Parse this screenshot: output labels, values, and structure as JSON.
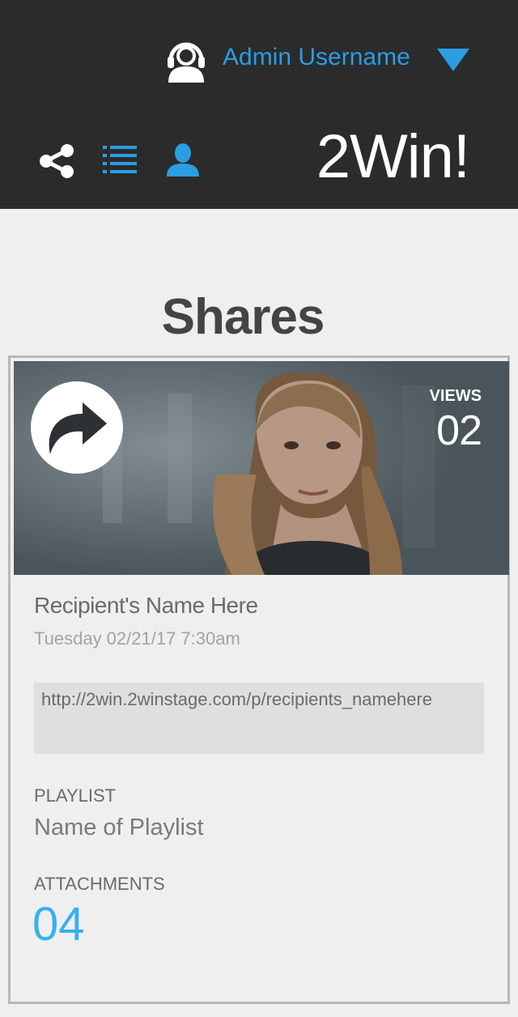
{
  "header": {
    "user_name": "Admin Username",
    "brand": "2Win!",
    "icons": {
      "user": "user-headset-icon",
      "dropdown": "caret-down-icon",
      "share": "share-icon",
      "list": "list-icon",
      "profile": "person-icon"
    },
    "colors": {
      "bar": "#2b2b2b",
      "accent": "#2b9de3"
    }
  },
  "page": {
    "title": "Shares"
  },
  "share_card": {
    "views_label": "VIEWS",
    "views": "02",
    "recipient": "Recipient's Name Here",
    "date": "Tuesday 02/21/17 7:30am",
    "link": "http://2win.2winstage.com/p/recipients_namehere",
    "playlist_label": "PLAYLIST",
    "playlist": "Name of Playlist",
    "attachments_label": "ATTACHMENTS",
    "attachments": "04",
    "badge_icon": "forward-arrow-icon",
    "attachments_color": "#38b0ee"
  }
}
